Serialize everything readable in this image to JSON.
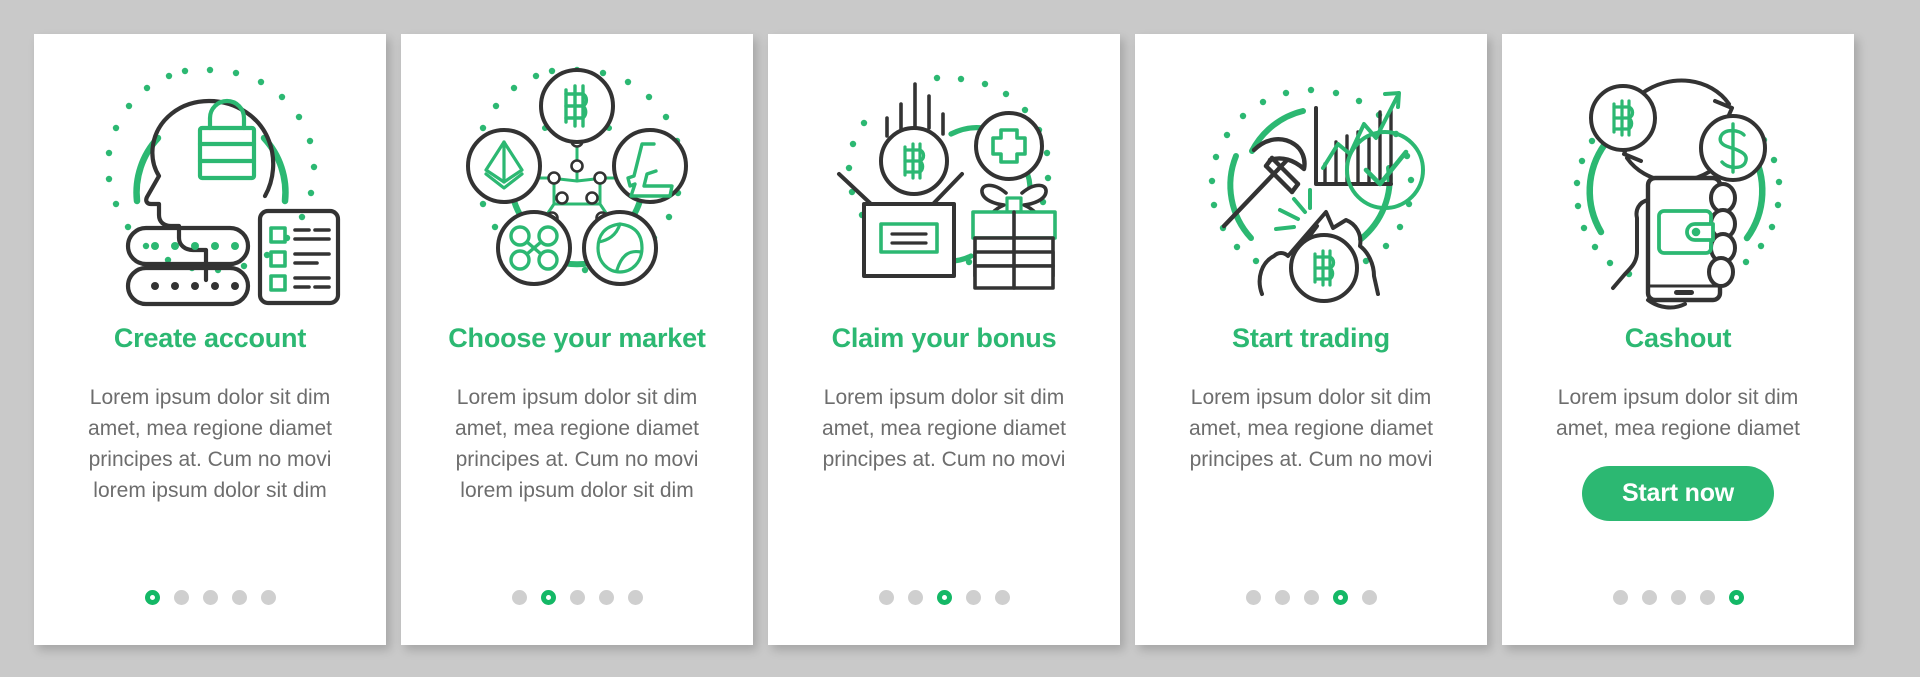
{
  "theme": {
    "background": "#c9c9c9",
    "card_background": "#ffffff",
    "accent_green": "#2cb872",
    "dot_inactive": "#cfcfcf",
    "dot_active": "#14b866",
    "body_text_color": "#6d6d6d",
    "line_dark": "#333333"
  },
  "pagination": {
    "total_dots": 5
  },
  "cards": [
    {
      "title": "Create account",
      "body": "Lorem ipsum dolor sit dim amet, mea regione diamet principes at. Cum no movi lorem ipsum dolor sit dim",
      "active_dot": 1,
      "illustration": "head-lock-password-checklist-icon",
      "illustration_parts": [
        "head-profile-icon",
        "padlock-icon",
        "password-field-icon",
        "checklist-document-icon",
        "dotted-circle-icon"
      ]
    },
    {
      "title": "Choose your market",
      "body": "Lorem ipsum dolor sit dim amet, mea regione diamet principes at. Cum no movi lorem ipsum dolor sit dim",
      "active_dot": 2,
      "illustration": "crypto-network-pentagon-icon",
      "illustration_parts": [
        "bitcoin-coin-icon",
        "ethereum-coin-icon",
        "litecoin-coin-icon",
        "ripple-coin-icon",
        "nem-coin-icon",
        "network-links-icon",
        "dotted-circle-icon"
      ]
    },
    {
      "title": "Claim your bonus",
      "body": "Lorem ipsum dolor sit dim amet, mea regione diamet principes at. Cum no movi",
      "active_dot": 3,
      "illustration": "open-box-gift-bonus-icon",
      "illustration_parts": [
        "open-box-icon",
        "bitcoin-coin-icon",
        "plus-circle-icon",
        "gift-box-icon",
        "dotted-circle-icon"
      ]
    },
    {
      "title": "Start trading",
      "body": "Lorem ipsum dolor sit dim amet, mea regione diamet principes at. Cum no movi",
      "active_dot": 4,
      "illustration": "mining-pickaxe-chart-icon",
      "illustration_parts": [
        "pickaxe-icon",
        "bar-chart-growth-icon",
        "check-circle-icon",
        "bitcoin-coin-icon",
        "rock-icon",
        "dotted-circle-icon"
      ]
    },
    {
      "title": "Cashout",
      "body": "Lorem ipsum dolor sit dim amet, mea regione diamet",
      "active_dot": 5,
      "cta_label": "Start now",
      "illustration": "phone-wallet-exchange-icon",
      "illustration_parts": [
        "bitcoin-coin-icon",
        "dollar-coin-icon",
        "exchange-arrows-icon",
        "hand-holding-phone-icon",
        "wallet-icon",
        "dotted-circle-icon"
      ]
    }
  ]
}
